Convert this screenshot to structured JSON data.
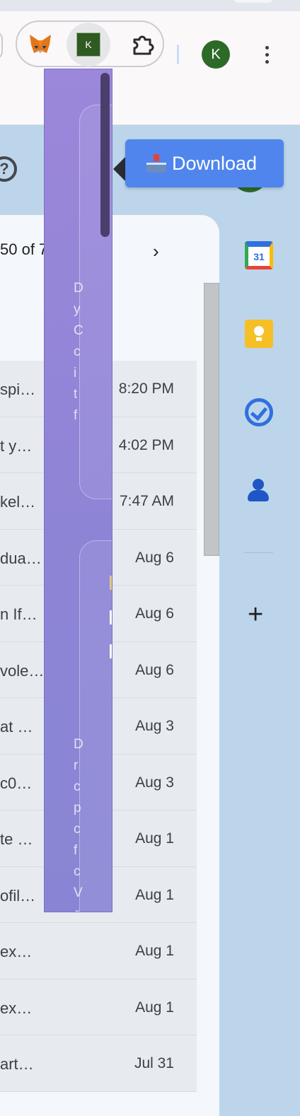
{
  "browser": {
    "extensions": [
      {
        "name": "MetaMask",
        "icon": "fox-icon"
      },
      {
        "name": "K",
        "icon": "k-square-icon",
        "label": "K"
      },
      {
        "name": "Extensions",
        "icon": "puzzle-icon"
      }
    ],
    "profile_initial": "K",
    "menu_icon": "kebab-icon"
  },
  "gmail": {
    "help_icon": "?",
    "pagination_text": "50 of 7",
    "next_icon": "›",
    "rows": [
      {
        "subject": "spi…",
        "date": "8:20 PM"
      },
      {
        "subject": "t y…",
        "date": "4:02 PM"
      },
      {
        "subject": "kel…",
        "date": "7:47 AM"
      },
      {
        "subject": "dua…",
        "date": "Aug 6"
      },
      {
        "subject": "n If…",
        "date": "Aug 6"
      },
      {
        "subject": "vole…",
        "date": "Aug 6"
      },
      {
        "subject": "at …",
        "date": "Aug 3"
      },
      {
        "subject": "c0…",
        "date": "Aug 3"
      },
      {
        "subject": "te …",
        "date": "Aug 1"
      },
      {
        "subject": "ofil…",
        "date": "Aug 1"
      },
      {
        "subject": " ex…",
        "date": "Aug 1"
      },
      {
        "subject": " ex…",
        "date": "Aug 1"
      },
      {
        "subject": "art…",
        "date": "Jul 31"
      }
    ]
  },
  "side_panel": {
    "calendar_label": "31",
    "plus": "+"
  },
  "popup": {
    "card1_text": "D\ny\nC\nc\ni\nt\nf",
    "card2_text": "D\nr\nc\np\nc\nf\nc\nV\ne"
  },
  "download_button": {
    "label": "Download",
    "icon": "inbox-tray-icon"
  }
}
